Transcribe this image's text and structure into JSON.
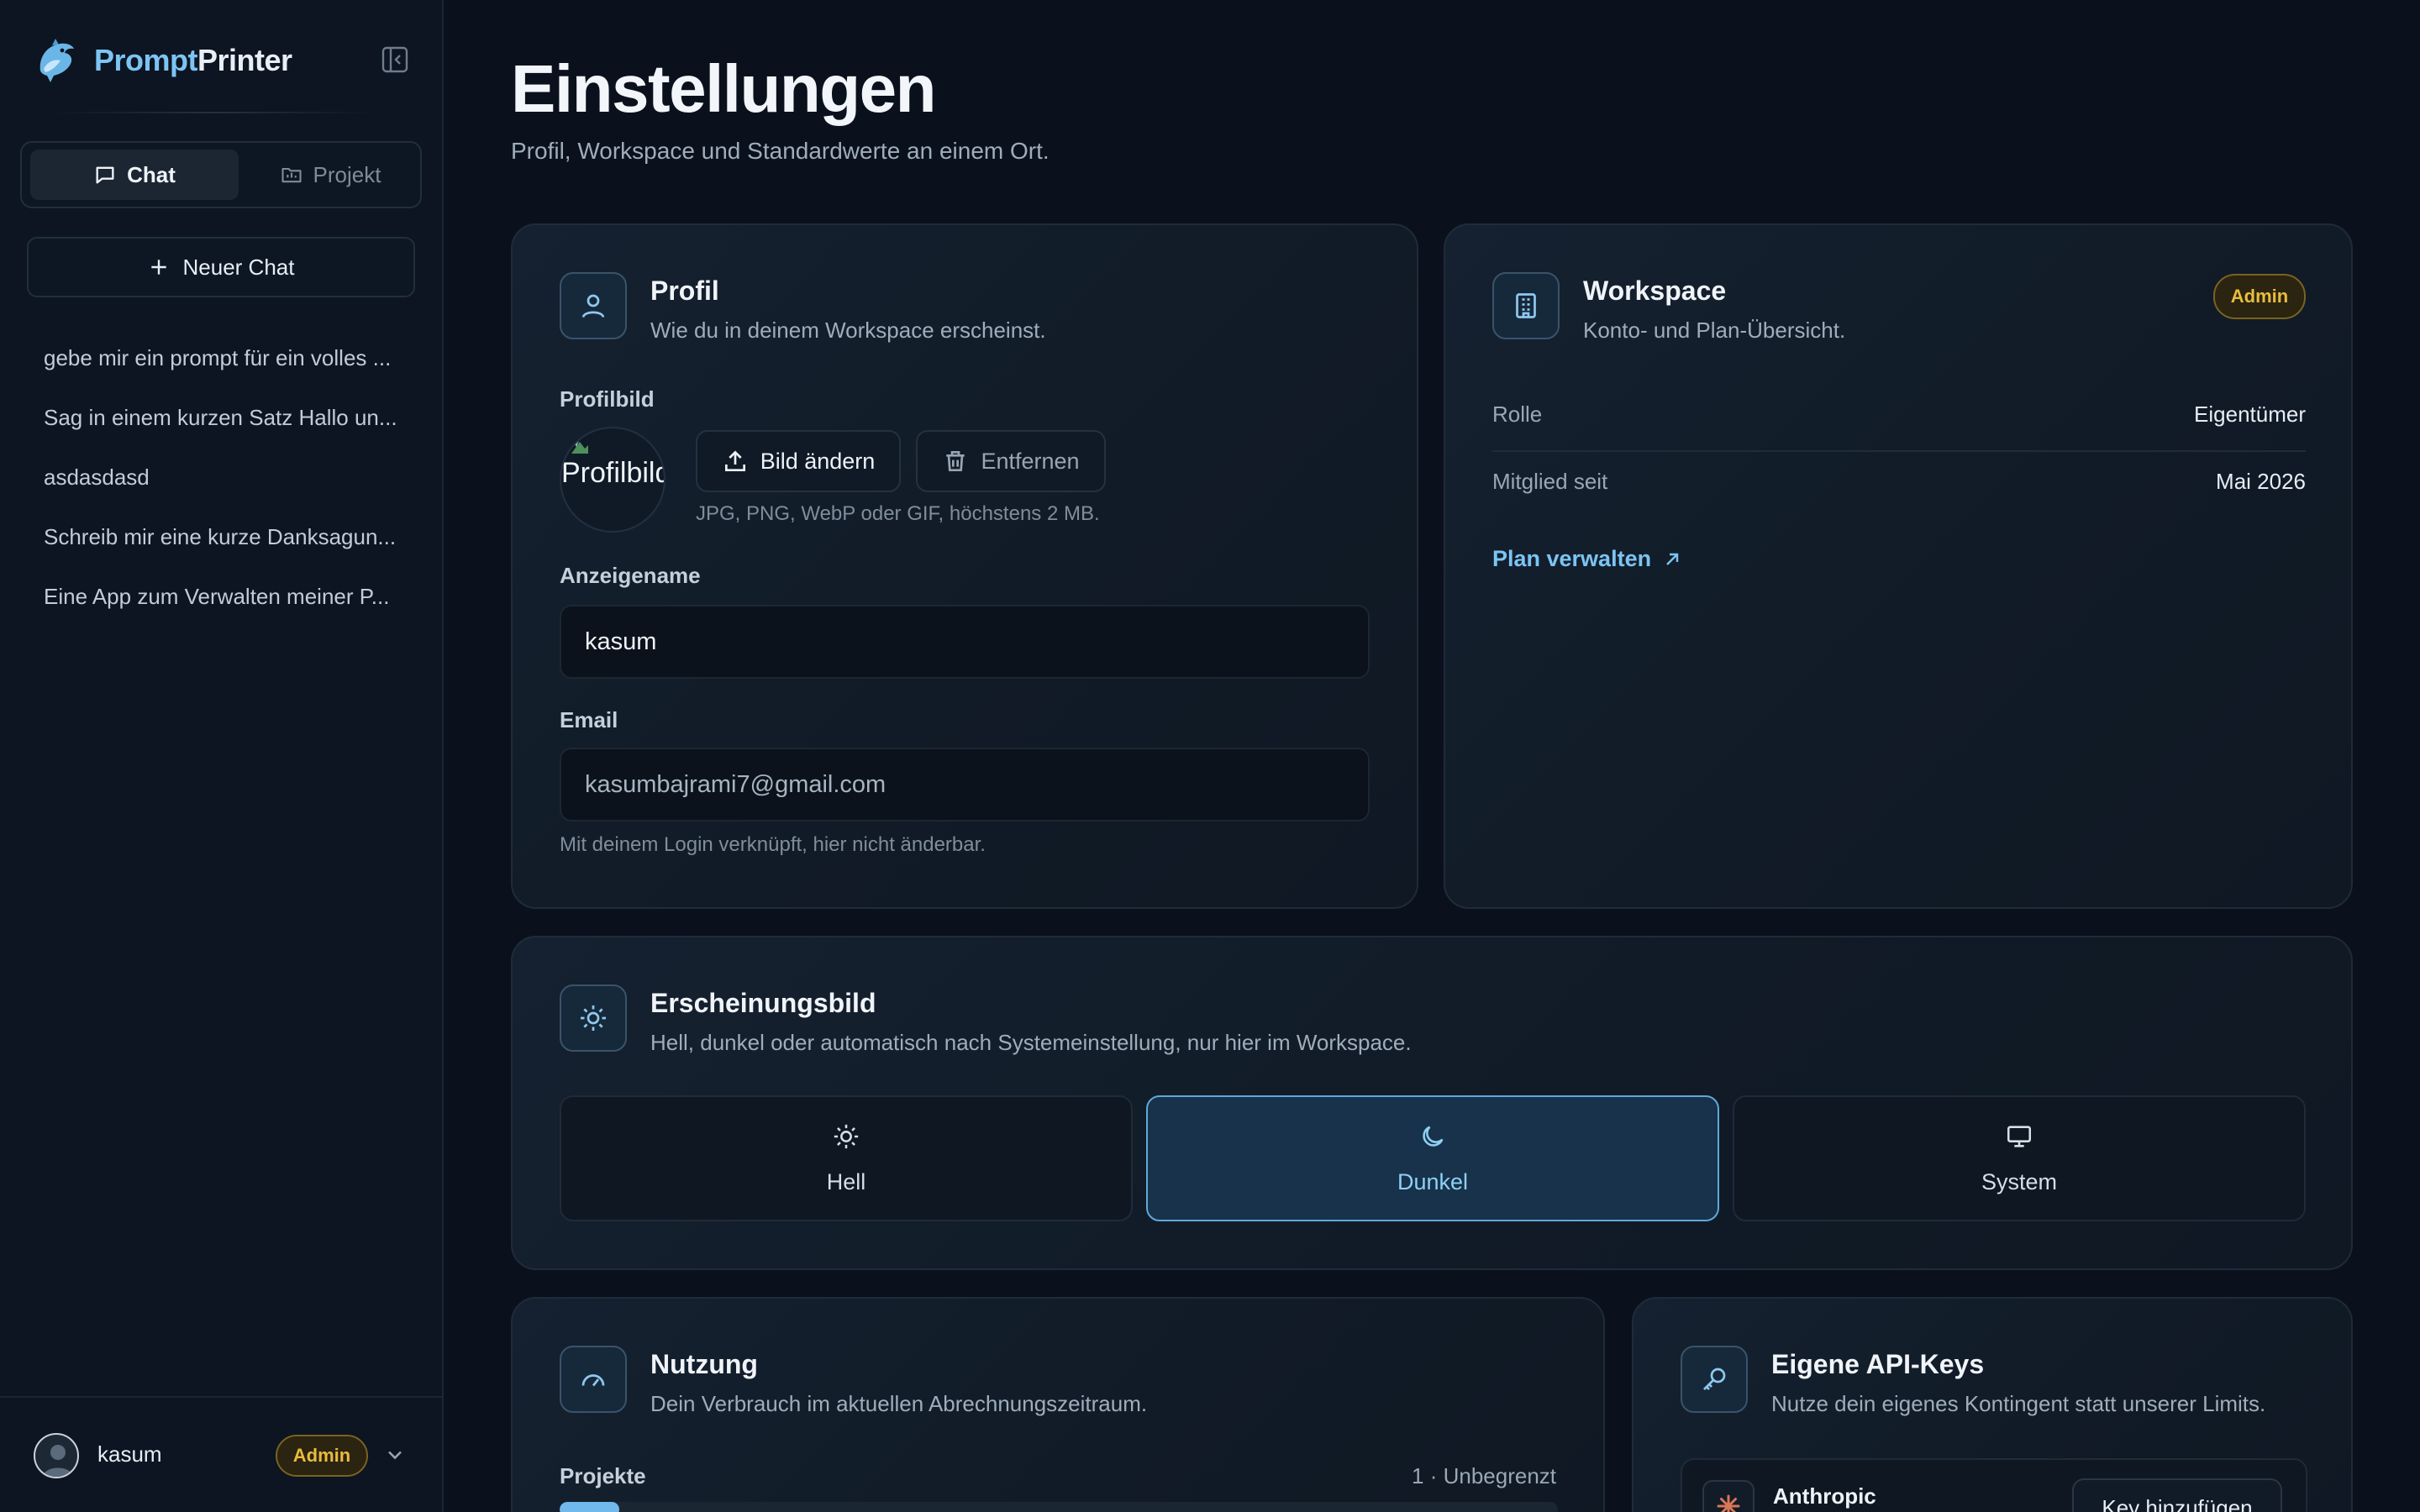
{
  "brand": {
    "name_part1": "Prompt",
    "name_part2": "Printer"
  },
  "sidebar": {
    "modes": [
      {
        "label": "Chat",
        "active": true
      },
      {
        "label": "Projekt",
        "active": false
      }
    ],
    "new_chat_label": "Neuer Chat",
    "chats": [
      "gebe mir ein prompt für ein volles ...",
      "Sag in einem kurzen Satz Hallo un...",
      "asdasdasd",
      "Schreib mir eine kurze Danksagun...",
      "Eine App zum Verwalten meiner P..."
    ],
    "user": {
      "name": "kasum",
      "role_badge": "Admin"
    }
  },
  "page": {
    "title": "Einstellungen",
    "subtitle": "Profil, Workspace und Standardwerte an einem Ort."
  },
  "profile": {
    "title": "Profil",
    "subtitle": "Wie du in deinem Workspace erscheinst.",
    "picture_label": "Profilbild",
    "picture_alt": "Profilbild",
    "change_label": "Bild ändern",
    "remove_label": "Entfernen",
    "picture_hint": "JPG, PNG, WebP oder GIF, höchstens 2 MB.",
    "display_name_label": "Anzeigename",
    "display_name_value": "kasum",
    "email_label": "Email",
    "email_value": "kasumbajrami7@gmail.com",
    "email_hint": "Mit deinem Login verknüpft, hier nicht änderbar."
  },
  "workspace": {
    "title": "Workspace",
    "subtitle": "Konto- und Plan-Übersicht.",
    "badge": "Admin",
    "rows": [
      {
        "key": "Rolle",
        "value": "Eigentümer"
      },
      {
        "key": "Mitglied seit",
        "value": "Mai 2026"
      }
    ],
    "plan_link": "Plan verwalten"
  },
  "appearance": {
    "title": "Erscheinungsbild",
    "subtitle": "Hell, dunkel oder automatisch nach Systemeinstellung, nur hier im Workspace.",
    "options": [
      {
        "label": "Hell",
        "icon": "sun-icon"
      },
      {
        "label": "Dunkel",
        "icon": "moon-icon"
      },
      {
        "label": "System",
        "icon": "monitor-icon"
      }
    ],
    "selected": "Dunkel"
  },
  "usage": {
    "title": "Nutzung",
    "subtitle": "Dein Verbrauch im aktuellen Abrechnungszeitraum.",
    "projects_label": "Projekte",
    "projects_value": "1 · Unbegrenzt",
    "projects_fill_fraction": 0.06
  },
  "apikeys": {
    "title": "Eigene API-Keys",
    "subtitle": "Nutze dein eigenes Kontingent statt unserer Limits.",
    "provider": "Anthropic",
    "add_key_label": "Key hinzufügen"
  },
  "colors": {
    "accent": "#7cc4f3",
    "admin_badge": "#e9bc3e",
    "background": "#0a111c",
    "anthropic": "#d97757"
  }
}
